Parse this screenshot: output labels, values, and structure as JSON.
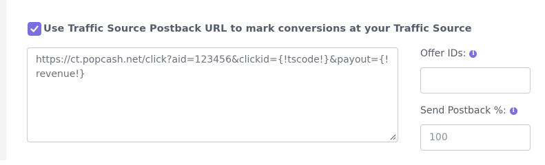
{
  "postback_toggle": {
    "checked": true,
    "label": "Use Traffic Source Postback URL to mark conversions at your Traffic Source"
  },
  "postback_url": {
    "value": "https://ct.popcash.net/click?aid=123456&clickid={!tscode!}&payout={!revenue!}"
  },
  "offer_ids": {
    "label": "Offer IDs:",
    "value": "",
    "info_icon": "info-icon"
  },
  "send_postback_percent": {
    "label": "Send Postback %:",
    "placeholder": "100",
    "value": "",
    "info_icon": "info-icon"
  },
  "colors": {
    "accent": "#7a6fdc",
    "text": "#555c6a",
    "border": "#c8cbd2"
  }
}
